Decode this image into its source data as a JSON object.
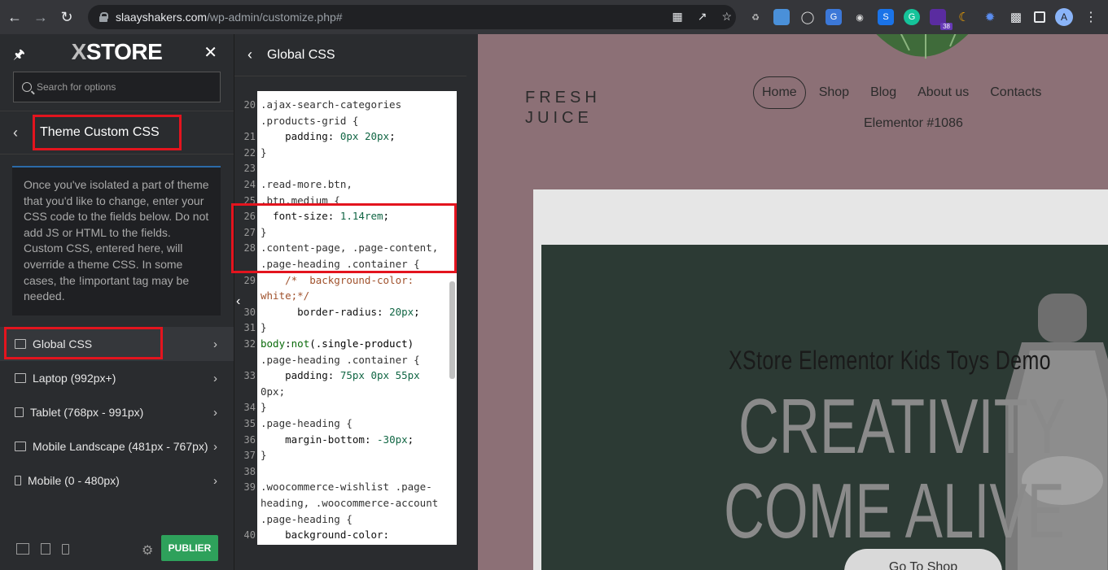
{
  "browser": {
    "url_domain": "slaayshakers.com",
    "url_path": "/wp-admin/customize.php#",
    "ext_badge": "38",
    "avatar_letter": "A"
  },
  "sidebar": {
    "logo_x": "X",
    "logo_text": "STORE",
    "search_placeholder": "Search for options",
    "section_title": "Theme Custom CSS",
    "description": "Once you've isolated a part of theme that you'd like to change, enter your CSS code to the fields below. Do not add JS or HTML to the fields. Custom CSS, entered here, will override a theme CSS. In some cases, the !important tag may be needed.",
    "menu": [
      {
        "label": "Global CSS"
      },
      {
        "label": "Laptop (992px+)"
      },
      {
        "label": "Tablet (768px - 991px)"
      },
      {
        "label": "Mobile Landscape (481px - 767px)"
      },
      {
        "label": "Mobile (0 - 480px)"
      }
    ],
    "publish_label": "PUBLIER"
  },
  "code_panel": {
    "title": "Global CSS",
    "lines": [
      {
        "n": "20",
        "t": ".ajax-search-categories"
      },
      {
        "n": "",
        "t": ".products-grid {"
      },
      {
        "n": "21",
        "t": "    padding: 0px 20px;"
      },
      {
        "n": "22",
        "t": "}"
      },
      {
        "n": "23",
        "t": ""
      },
      {
        "n": "24",
        "t": ".read-more.btn,"
      },
      {
        "n": "25",
        "t": ".btn.medium {"
      },
      {
        "n": "26",
        "t": "  font-size: 1.14rem;"
      },
      {
        "n": "27",
        "t": "}"
      },
      {
        "n": "28",
        "t": ".content-page, .page-content,"
      },
      {
        "n": "",
        "t": ".page-heading .container {"
      },
      {
        "n": "29",
        "t": "    /*  background-color:"
      },
      {
        "n": "",
        "t": "white;*/"
      },
      {
        "n": "30",
        "t": "      border-radius: 20px;"
      },
      {
        "n": "31",
        "t": "}"
      },
      {
        "n": "32",
        "t": "body:not(.single-product)"
      },
      {
        "n": "",
        "t": ".page-heading .container {"
      },
      {
        "n": "33",
        "t": "    padding: 75px 0px 55px"
      },
      {
        "n": "",
        "t": "0px;"
      },
      {
        "n": "34",
        "t": "}"
      },
      {
        "n": "35",
        "t": ".page-heading {"
      },
      {
        "n": "36",
        "t": "    margin-bottom: -30px;"
      },
      {
        "n": "37",
        "t": "}"
      },
      {
        "n": "38",
        "t": ""
      },
      {
        "n": "39",
        "t": ".woocommerce-wishlist .page-"
      },
      {
        "n": "",
        "t": "heading, .woocommerce-account"
      },
      {
        "n": "",
        "t": ".page-heading {"
      },
      {
        "n": "40",
        "t": "    background-color:"
      }
    ]
  },
  "preview": {
    "brand_line1": "FRESH",
    "brand_line2": "JUICE",
    "nav": [
      "Home",
      "Shop",
      "Blog",
      "About us",
      "Contacts"
    ],
    "sub_nav": "Elementor #1086",
    "hero_subtitle": "XStore Elementor Kids Toys Demo",
    "hero_line1": "CREATIVITY",
    "hero_line2": "COME ALIVE",
    "cta": "Go To Shop"
  }
}
